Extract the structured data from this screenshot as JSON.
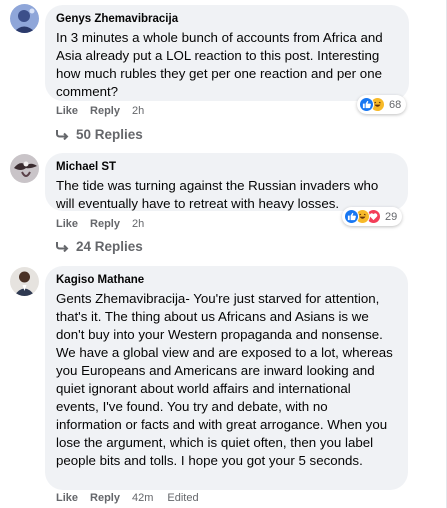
{
  "comments": [
    {
      "author": "Genys Zhemavibracija",
      "text": "In 3 minutes a whole bunch of accounts from Africa and Asia already put a LOL reaction to this post. Interesting how much rubles they get per one reaction and per one comment?",
      "like_label": "Like",
      "reply_label": "Reply",
      "time": "2h",
      "reaction_count": "68",
      "reaction_icons": [
        "like-icon",
        "haha-icon"
      ],
      "replies_label": "50 Replies"
    },
    {
      "author": "Michael ST",
      "text": "The tide was turning against the Russian invaders who will eventually have to retreat with heavy losses.",
      "like_label": "Like",
      "reply_label": "Reply",
      "time": "2h",
      "reaction_count": "29",
      "reaction_icons": [
        "like-icon",
        "haha-icon",
        "love-icon"
      ],
      "replies_label": "24 Replies"
    },
    {
      "author": "Kagiso Mathane",
      "text": "Gents Zhemavibracija- You're just starved for attention, that's it. The thing about us Africans and Asians is we don't buy into your Western propaganda and nonsense. We have a global view and are exposed to a lot, whereas you Europeans and Americans are inward looking and quiet ignorant about world affairs and international events, I've found. You try and debate, with no information or facts and with great arrogance. When you lose the argument, which is quiet often, then you label people bits and tolls. I hope you got your 5 seconds.",
      "like_label": "Like",
      "reply_label": "Reply",
      "time": "42m",
      "edited_label": "Edited"
    }
  ],
  "colors": {
    "bubble": "#f0f2f5",
    "meta_text": "#65676b",
    "like_blue": "#1877f2",
    "haha_yellow": "#f7b928",
    "love_red": "#f33e58"
  }
}
